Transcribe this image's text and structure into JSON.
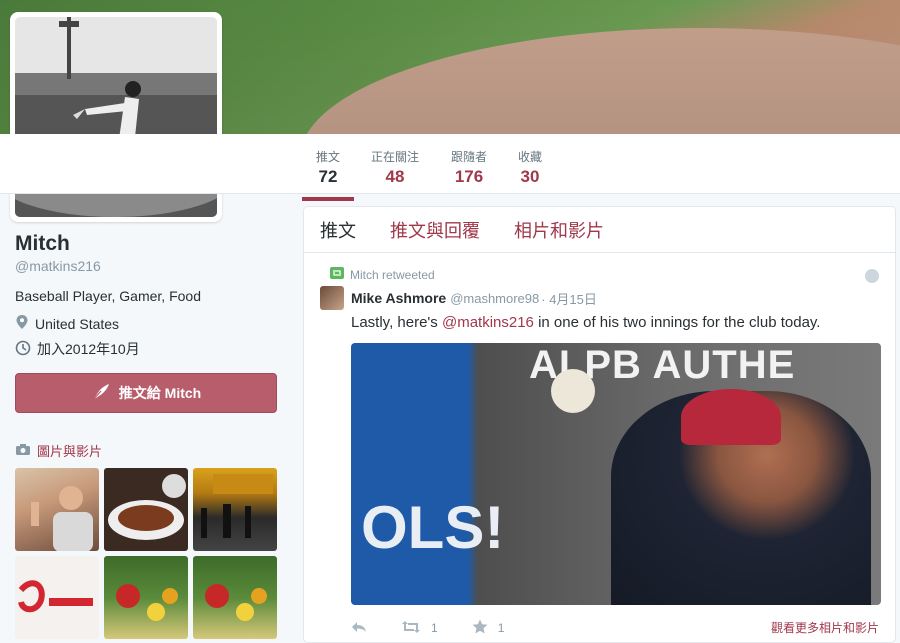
{
  "colors": {
    "accent": "#a0384b",
    "button": "#b85d6c"
  },
  "nav": {
    "stats": [
      {
        "label": "推文",
        "value": "72"
      },
      {
        "label": "正在關注",
        "value": "48"
      },
      {
        "label": "跟隨者",
        "value": "176"
      },
      {
        "label": "收藏",
        "value": "30"
      }
    ]
  },
  "profile": {
    "name": "Mitch",
    "handle": "@matkins216",
    "bio": "Baseball Player, Gamer, Food",
    "location": "United States",
    "joined": "加入2012年10月",
    "tweet_to_label": "推文給 Mitch",
    "media_label": "圖片與影片"
  },
  "timeline": {
    "tabs": [
      "推文",
      "推文與回覆",
      "相片和影片"
    ],
    "tweet": {
      "retweet_note": "Mitch retweeted",
      "author": "Mike Ashmore",
      "author_handle": "@mashmore98",
      "date": "· 4月15日",
      "text_before": "Lastly, here's ",
      "mention": "@matkins216",
      "text_after": " in one of his two innings for the club today.",
      "photo_sign": "ALPB AUTHE",
      "photo_banner": "OLS!",
      "retweets": "1",
      "favorites": "1",
      "more_media_label": "觀看更多相片和影片"
    }
  }
}
